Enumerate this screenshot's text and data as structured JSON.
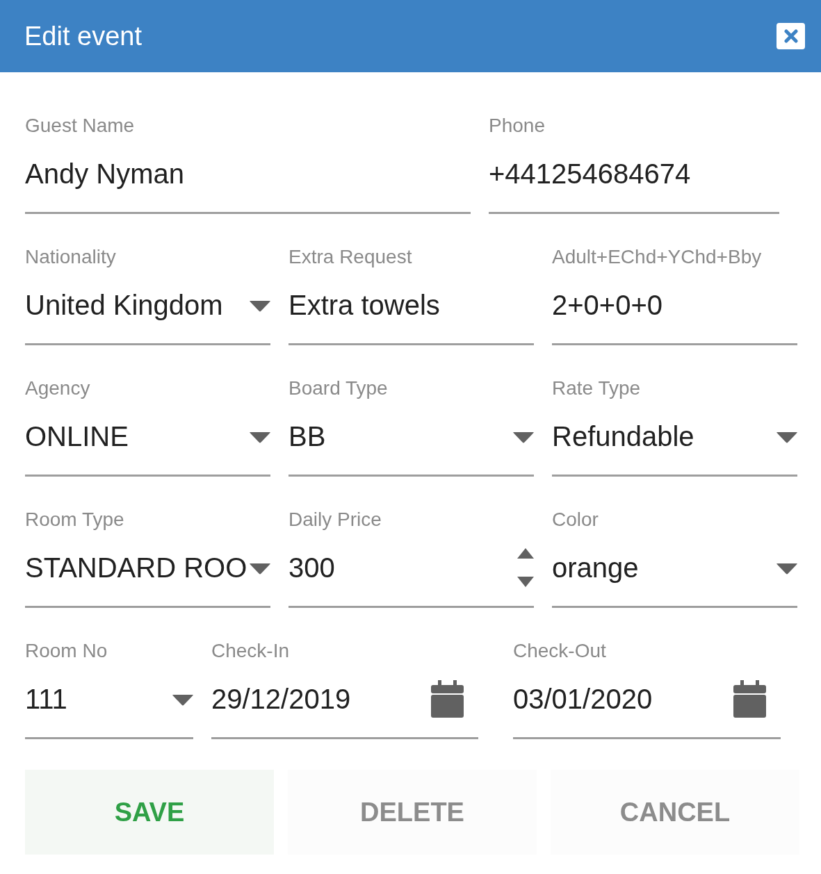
{
  "dialog": {
    "title": "Edit event"
  },
  "rows": [
    [
      {
        "label": "Guest Name",
        "kind": "text",
        "value": "Andy Nyman"
      },
      {
        "label": "Phone",
        "kind": "text",
        "value": "+441254684674"
      }
    ],
    [
      {
        "label": "Nationality",
        "kind": "select",
        "value": "United Kingdom"
      },
      {
        "label": "Extra Request",
        "kind": "text",
        "value": "Extra towels"
      },
      {
        "label": "Adult+EChd+YChd+Bby",
        "kind": "text",
        "value": "2+0+0+0"
      }
    ],
    [
      {
        "label": "Agency",
        "kind": "select",
        "value": "ONLINE"
      },
      {
        "label": "Board Type",
        "kind": "select",
        "value": "BB"
      },
      {
        "label": "Rate Type",
        "kind": "select",
        "value": "Refundable"
      }
    ],
    [
      {
        "label": "Room Type",
        "kind": "select",
        "value": "STANDARD ROO"
      },
      {
        "label": "Daily Price",
        "kind": "number",
        "value": "300"
      },
      {
        "label": "Color",
        "kind": "select",
        "value": "orange"
      }
    ],
    [
      {
        "label": "Room No",
        "kind": "select",
        "value": "111"
      },
      {
        "label": "Check-In",
        "kind": "date",
        "value": "29/12/2019"
      },
      {
        "label": "Check-Out",
        "kind": "date",
        "value": "03/01/2020"
      }
    ]
  ],
  "buttons": [
    {
      "label": "SAVE",
      "kind": "primary"
    },
    {
      "label": "DELETE",
      "kind": "default"
    },
    {
      "label": "CANCEL",
      "kind": "default"
    }
  ]
}
